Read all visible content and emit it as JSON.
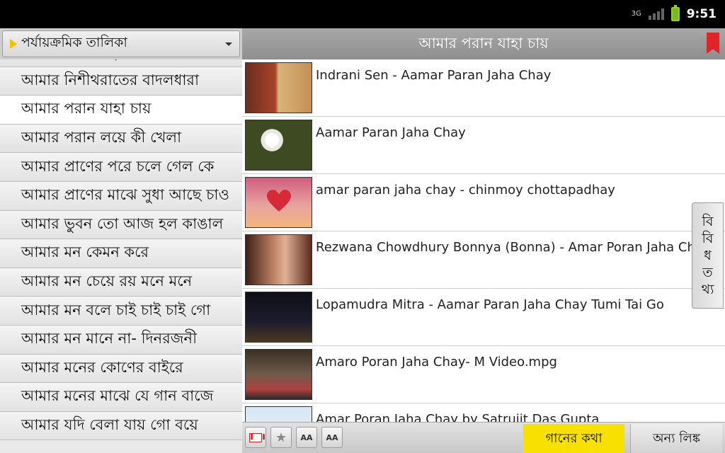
{
  "status_bar": {
    "network": "3G",
    "time": "9:51"
  },
  "left_panel": {
    "dropdown_label": "পর্যায়ক্রমিক তালিকা",
    "items": [
      "আমার নিখিল ভুবন হারালেম",
      "আমার নিশীথরাতের বাদলধারা",
      "আমার পরান যাহা চায়",
      "আমার পরান লয়ে কী খেলা",
      "আমার প্রাণের পরে চলে গেল কে",
      "আমার প্রাণের মাঝে সুধা আছে চাও",
      "আমার ভুবন তো আজ হল কাঙাল",
      "আমার মন কেমন করে",
      "আমার মন চেয়ে রয় মনে মনে",
      "আমার মন বলে চাই চাই চাই গো",
      "আমার মন মানে না- দিনরজনী",
      "আমার মনের কোণের বাইরে",
      "আমার মনের মাঝে যে গান বাজে",
      "আমার যদি বেলা যায় গো বয়ে"
    ],
    "active_index": 2
  },
  "header": {
    "title": "আমার পরান যাহা চায়"
  },
  "videos": [
    {
      "title": "Indrani Sen - Aamar Paran Jaha Chay"
    },
    {
      "title": "Aamar Paran Jaha Chay"
    },
    {
      "title": "amar paran jaha chay - chinmoy chottapadhay"
    },
    {
      "title": "Rezwana Chowdhury Bonnya (Bonna) - Amar Poran Jaha Chay"
    },
    {
      "title": "Lopamudra Mitra - Aamar Paran Jaha Chay Tumi Tai Go"
    },
    {
      "title": "Amaro Poran Jaha Chay- M Video.mpg"
    },
    {
      "title": "Amar Poran Jaha Chay by Satrujit Das Gupta"
    }
  ],
  "side_tab": {
    "chars": [
      "বি",
      "বি",
      "ধ",
      "ত",
      "থ্য"
    ]
  },
  "bottom_bar": {
    "font_small_label": "AA",
    "font_large_label": "AA",
    "lyrics_label": "গানের কথা",
    "links_label": "অন্য লিঙ্ক"
  },
  "colors": {
    "accent_yellow": "#f8e100",
    "bookmark_red": "#e0252a",
    "header_gray": "#9a9a9a"
  },
  "icons": [
    "play-triangle-icon",
    "caret-down-icon",
    "bookmark-icon",
    "gmail-icon",
    "star-icon",
    "font-decrease-icon",
    "font-increase-icon",
    "signal-icon",
    "battery-icon"
  ]
}
